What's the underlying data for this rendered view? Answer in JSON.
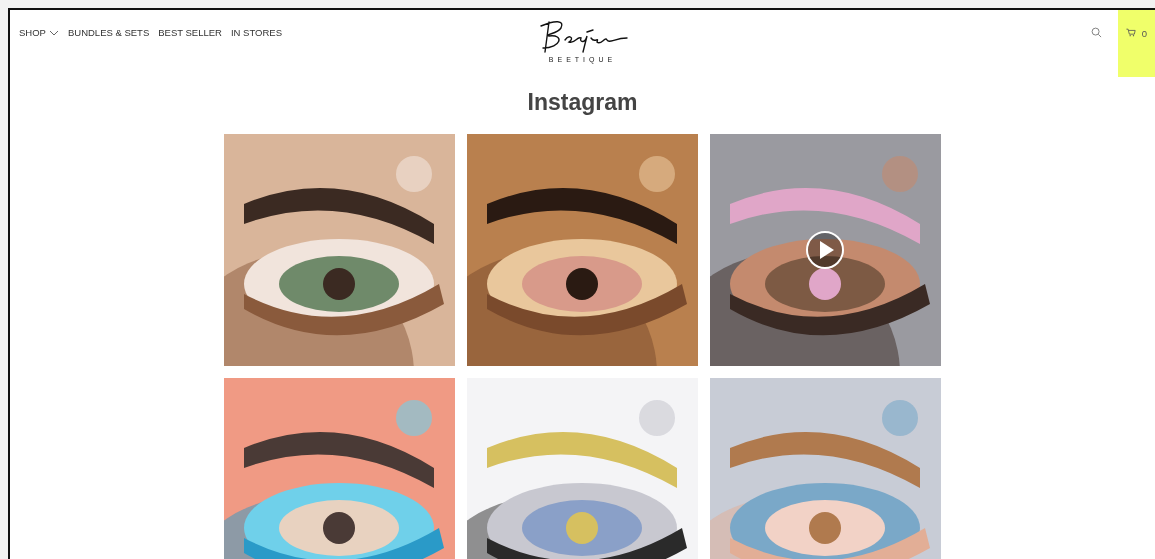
{
  "nav": [
    {
      "label": "SHOP",
      "dropdown": true
    },
    {
      "label": "BUNDLES & SETS",
      "dropdown": false
    },
    {
      "label": "BEST SELLER",
      "dropdown": false
    },
    {
      "label": "IN STORES",
      "dropdown": false
    }
  ],
  "logo": {
    "wordmark": "BEETIQUE"
  },
  "cart": {
    "count": "0"
  },
  "heading": "Instagram",
  "posts": [
    {
      "kind": "picture",
      "video": false
    },
    {
      "kind": "picture",
      "video": false
    },
    {
      "kind": "picture",
      "video": true
    },
    {
      "kind": "picture",
      "video": false
    },
    {
      "kind": "picture",
      "video": false
    },
    {
      "kind": "picture",
      "video": false
    }
  ]
}
